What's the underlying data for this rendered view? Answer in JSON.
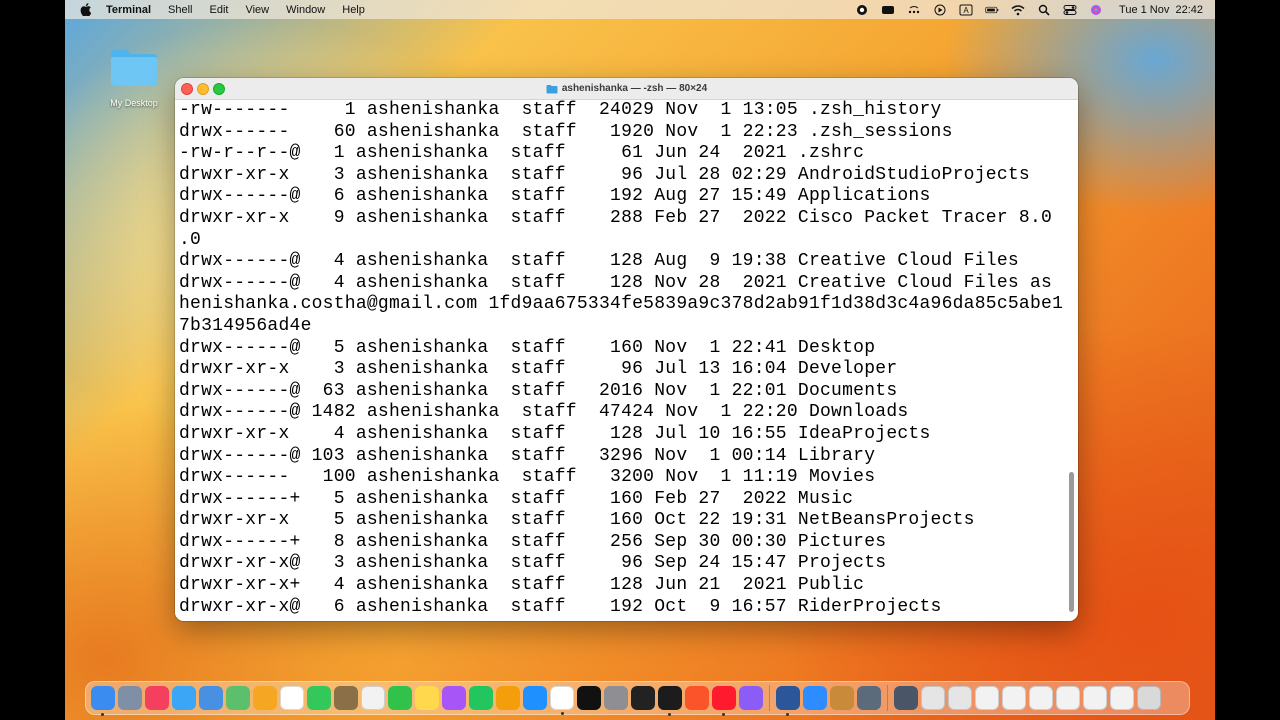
{
  "menubar": {
    "app_name": "Terminal",
    "menus": [
      "Shell",
      "Edit",
      "View",
      "Window",
      "Help"
    ],
    "clock": "Tue 1 Nov  22:42",
    "status_icons": [
      "record-icon",
      "facetime-icon",
      "dots-icon",
      "play-icon",
      "text-input-icon",
      "battery-icon",
      "wifi-icon",
      "search-icon",
      "control-center-icon",
      "siri-icon"
    ]
  },
  "desktop": {
    "folder_label": "My Desktop"
  },
  "terminal": {
    "title": "ashenishanka — -zsh — 80×24",
    "lines": [
      "-rw-------     1 ashenishanka  staff  24029 Nov  1 13:05 .zsh_history",
      "drwx------    60 ashenishanka  staff   1920 Nov  1 22:23 .zsh_sessions",
      "-rw-r--r--@   1 ashenishanka  staff     61 Jun 24  2021 .zshrc",
      "drwxr-xr-x    3 ashenishanka  staff     96 Jul 28 02:29 AndroidStudioProjects",
      "drwx------@   6 ashenishanka  staff    192 Aug 27 15:49 Applications",
      "drwxr-xr-x    9 ashenishanka  staff    288 Feb 27  2022 Cisco Packet Tracer 8.0",
      ".0",
      "drwx------@   4 ashenishanka  staff    128 Aug  9 19:38 Creative Cloud Files",
      "drwx------@   4 ashenishanka  staff    128 Nov 28  2021 Creative Cloud Files as",
      "henishanka.costha@gmail.com 1fd9aa675334fe5839a9c378d2ab91f1d38d3c4a96da85c5abe1",
      "7b314956ad4e",
      "drwx------@   5 ashenishanka  staff    160 Nov  1 22:41 Desktop",
      "drwxr-xr-x    3 ashenishanka  staff     96 Jul 13 16:04 Developer",
      "drwx------@  63 ashenishanka  staff   2016 Nov  1 22:01 Documents",
      "drwx------@ 1482 ashenishanka  staff  47424 Nov  1 22:20 Downloads",
      "drwxr-xr-x    4 ashenishanka  staff    128 Jul 10 16:55 IdeaProjects",
      "drwx------@ 103 ashenishanka  staff   3296 Nov  1 00:14 Library",
      "drwx------   100 ashenishanka  staff   3200 Nov  1 11:19 Movies",
      "drwx------+   5 ashenishanka  staff    160 Feb 27  2022 Music",
      "drwxr-xr-x    5 ashenishanka  staff    160 Oct 22 19:31 NetBeansProjects",
      "drwx------+   8 ashenishanka  staff    256 Sep 30 00:30 Pictures",
      "drwxr-xr-x@   3 ashenishanka  staff     96 Sep 24 15:47 Projects",
      "drwxr-xr-x+   4 ashenishanka  staff    128 Jun 21  2021 Public",
      "drwxr-xr-x@   6 ashenishanka  staff    192 Oct  9 16:57 RiderProjects"
    ]
  },
  "dock": {
    "apps": [
      {
        "name": "finder-icon",
        "color": "#3b8cf0",
        "running": true
      },
      {
        "name": "launchpad-icon",
        "color": "#7f8fa6",
        "running": false
      },
      {
        "name": "music-icon",
        "color": "#f43f5e",
        "running": false
      },
      {
        "name": "safari-icon",
        "color": "#3ba6f5",
        "running": false
      },
      {
        "name": "mail-icon",
        "color": "#4a90e2",
        "running": false
      },
      {
        "name": "maps-icon",
        "color": "#5cbf6b",
        "running": false
      },
      {
        "name": "photos-icon",
        "color": "#f5a623",
        "running": false
      },
      {
        "name": "calendar-icon",
        "color": "#ffffff",
        "running": false
      },
      {
        "name": "messages-icon",
        "color": "#34c759",
        "running": false
      },
      {
        "name": "archive-icon",
        "color": "#8b6f47",
        "running": false
      },
      {
        "name": "reminders-icon",
        "color": "#f2f2f2",
        "running": false
      },
      {
        "name": "facetime-app-icon",
        "color": "#30c24a",
        "running": false
      },
      {
        "name": "notes-icon",
        "color": "#ffd84d",
        "running": false
      },
      {
        "name": "podcasts-icon",
        "color": "#a855f7",
        "running": false
      },
      {
        "name": "numbers-icon",
        "color": "#22c55e",
        "running": false
      },
      {
        "name": "pages-icon",
        "color": "#f59e0b",
        "running": false
      },
      {
        "name": "app-store-icon",
        "color": "#1e90ff",
        "running": false
      },
      {
        "name": "chrome-icon",
        "color": "#ffffff",
        "running": true
      },
      {
        "name": "apple-tv-icon",
        "color": "#111111",
        "running": false
      },
      {
        "name": "system-settings-icon",
        "color": "#8e8e93",
        "running": false
      },
      {
        "name": "activity-monitor-icon",
        "color": "#222222",
        "running": false
      },
      {
        "name": "terminal-icon",
        "color": "#1c1c1c",
        "running": true
      },
      {
        "name": "brave-icon",
        "color": "#fb542b",
        "running": false
      },
      {
        "name": "opera-icon",
        "color": "#ff1b2d",
        "running": true
      },
      {
        "name": "feedback-icon",
        "color": "#8b5cf6",
        "running": false
      },
      {
        "name": "word-icon",
        "color": "#2b579a",
        "running": true
      },
      {
        "name": "zoom-icon",
        "color": "#2d8cff",
        "running": false
      },
      {
        "name": "game-icon",
        "color": "#c98b3a",
        "running": false
      },
      {
        "name": "quicktime-icon",
        "color": "#5b6b7c",
        "running": false
      },
      {
        "name": "screenshot-icon",
        "color": "#4a5568",
        "running": false
      },
      {
        "name": "unknown-icon",
        "color": "#e5e5e5",
        "running": false
      },
      {
        "name": "unknown-icon-2",
        "color": "#e5e5e5",
        "running": false
      },
      {
        "name": "doc-thumb-icon",
        "color": "#f2f2f2",
        "running": false
      },
      {
        "name": "doc-thumb-icon-2",
        "color": "#f2f2f2",
        "running": false
      },
      {
        "name": "doc-thumb-icon-3",
        "color": "#f2f2f2",
        "running": false
      },
      {
        "name": "doc-thumb-icon-4",
        "color": "#f2f2f2",
        "running": false
      },
      {
        "name": "doc-thumb-icon-5",
        "color": "#f2f2f2",
        "running": false
      },
      {
        "name": "doc-thumb-icon-6",
        "color": "#f2f2f2",
        "running": false
      },
      {
        "name": "trash-icon",
        "color": "#d9d9d9",
        "running": false
      }
    ]
  }
}
